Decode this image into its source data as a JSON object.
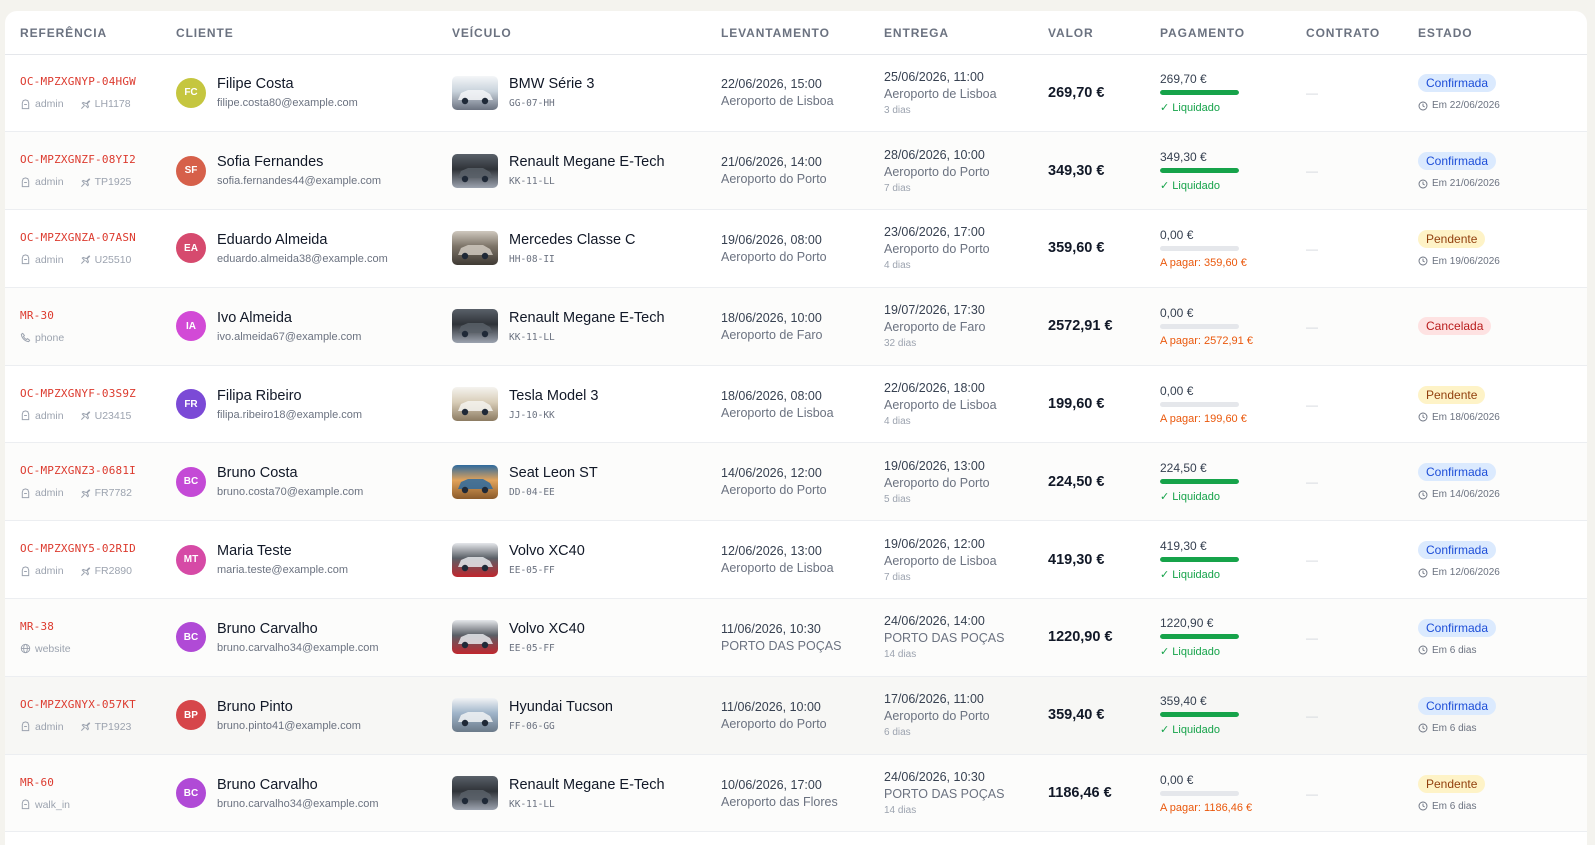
{
  "headers": [
    "REFERÊNCIA",
    "CLIENTE",
    "VEÍCULO",
    "LEVANTAMENTO",
    "ENTREGA",
    "VALOR",
    "PAGAMENTO",
    "CONTRATO",
    "ESTADO"
  ],
  "rows": [
    {
      "ref": "OC-MPZXGNYP-04HGW",
      "source": "admin",
      "flight": "LH1178",
      "source_icon": "user-icon",
      "initials": "FC",
      "avatar_color": "#c5c63f",
      "name": "Filipe Costa",
      "email": "filipe.costa80@example.com",
      "vehicle": "BMW Série 3",
      "plate": "GG-07-HH",
      "thumb": [
        "#c9d3dc",
        "#f4f6f8",
        "#6b7280"
      ],
      "pickup_dt": "22/06/2026, 15:00",
      "pickup_loc": "Aeroporto de Lisboa",
      "return_dt": "25/06/2026, 11:00",
      "return_loc": "Aeroporto de Lisboa",
      "days": "3 dias",
      "valor": "269,70 €",
      "paid": "269,70 €",
      "paid_ratio": 1,
      "pay_status": "✓ Liquidado",
      "pay_state": "ok",
      "contract": "—",
      "status": "Confirmada",
      "status_type": "conf",
      "status_sub": "Em 22/06/2026"
    },
    {
      "ref": "OC-MPZXGNZF-08YI2",
      "source": "admin",
      "flight": "TP1925",
      "source_icon": "user-icon",
      "initials": "SF",
      "avatar_color": "#d6604a",
      "name": "Sofia Fernandes",
      "email": "sofia.fernandes44@example.com",
      "vehicle": "Renault Megane E-Tech",
      "plate": "KK-11-LL",
      "thumb": [
        "#2f3338",
        "#596069",
        "#9ca3af"
      ],
      "pickup_dt": "21/06/2026, 14:00",
      "pickup_loc": "Aeroporto do Porto",
      "return_dt": "28/06/2026, 10:00",
      "return_loc": "Aeroporto do Porto",
      "days": "7 dias",
      "valor": "349,30 €",
      "paid": "349,30 €",
      "paid_ratio": 1,
      "pay_status": "✓ Liquidado",
      "pay_state": "ok",
      "contract": "—",
      "status": "Confirmada",
      "status_type": "conf",
      "status_sub": "Em 21/06/2026"
    },
    {
      "ref": "OC-MPZXGNZA-07ASN",
      "source": "admin",
      "flight": "U25510",
      "source_icon": "user-icon",
      "initials": "EA",
      "avatar_color": "#d64a6e",
      "name": "Eduardo Almeida",
      "email": "eduardo.almeida38@example.com",
      "vehicle": "Mercedes Classe C",
      "plate": "HH-08-II",
      "thumb": [
        "#7d7468",
        "#cfc8be",
        "#3f3a34"
      ],
      "pickup_dt": "19/06/2026, 08:00",
      "pickup_loc": "Aeroporto do Porto",
      "return_dt": "23/06/2026, 17:00",
      "return_loc": "Aeroporto do Porto",
      "days": "4 dias",
      "valor": "359,60 €",
      "paid": "0,00 €",
      "paid_ratio": 0,
      "pay_status": "A pagar: 359,60 €",
      "pay_state": "due",
      "contract": "—",
      "status": "Pendente",
      "status_type": "pend",
      "status_sub": "Em 19/06/2026"
    },
    {
      "ref": "MR-30",
      "source": "phone",
      "flight": "",
      "source_icon": "phone-icon",
      "initials": "IA",
      "avatar_color": "#d24ad6",
      "name": "Ivo Almeida",
      "email": "ivo.almeida67@example.com",
      "vehicle": "Renault Megane E-Tech",
      "plate": "KK-11-LL",
      "thumb": [
        "#2f3338",
        "#596069",
        "#9ca3af"
      ],
      "pickup_dt": "18/06/2026, 10:00",
      "pickup_loc": "Aeroporto de Faro",
      "return_dt": "19/07/2026, 17:30",
      "return_loc": "Aeroporto de Faro",
      "days": "32 dias",
      "valor": "2572,91 €",
      "paid": "0,00 €",
      "paid_ratio": 0,
      "pay_status": "A pagar: 2572,91 €",
      "pay_state": "due",
      "contract": "—",
      "status": "Cancelada",
      "status_type": "canc",
      "status_sub": ""
    },
    {
      "ref": "OC-MPZXGNYF-03S9Z",
      "source": "admin",
      "flight": "U23415",
      "source_icon": "user-icon",
      "initials": "FR",
      "avatar_color": "#7b4ad6",
      "name": "Filipa Ribeiro",
      "email": "filipa.ribeiro18@example.com",
      "vehicle": "Tesla Model 3",
      "plate": "JJ-10-KK",
      "thumb": [
        "#d8cdb8",
        "#f5f3ef",
        "#8c7b62"
      ],
      "pickup_dt": "18/06/2026, 08:00",
      "pickup_loc": "Aeroporto de Lisboa",
      "return_dt": "22/06/2026, 18:00",
      "return_loc": "Aeroporto de Lisboa",
      "days": "4 dias",
      "valor": "199,60 €",
      "paid": "0,00 €",
      "paid_ratio": 0,
      "pay_status": "A pagar: 199,60 €",
      "pay_state": "due",
      "contract": "—",
      "status": "Pendente",
      "status_type": "pend",
      "status_sub": "Em 18/06/2026"
    },
    {
      "ref": "OC-MPZXGNZ3-0681I",
      "source": "admin",
      "flight": "FR7782",
      "source_icon": "user-icon",
      "initials": "BC",
      "avatar_color": "#c44ad6",
      "name": "Bruno Costa",
      "email": "bruno.costa70@example.com",
      "vehicle": "Seat Leon ST",
      "plate": "DD-04-EE",
      "thumb": [
        "#e2a35a",
        "#2d6a9f",
        "#8a5a2b"
      ],
      "pickup_dt": "14/06/2026, 12:00",
      "pickup_loc": "Aeroporto do Porto",
      "return_dt": "19/06/2026, 13:00",
      "return_loc": "Aeroporto do Porto",
      "days": "5 dias",
      "valor": "224,50 €",
      "paid": "224,50 €",
      "paid_ratio": 1,
      "pay_status": "✓ Liquidado",
      "pay_state": "ok",
      "contract": "—",
      "status": "Confirmada",
      "status_type": "conf",
      "status_sub": "Em 14/06/2026"
    },
    {
      "ref": "OC-MPZXGNY5-02RID",
      "source": "admin",
      "flight": "FR2890",
      "source_icon": "user-icon",
      "initials": "MT",
      "avatar_color": "#d64aa6",
      "name": "Maria Teste",
      "email": "maria.teste@example.com",
      "vehicle": "Volvo XC40",
      "plate": "EE-05-FF",
      "thumb": [
        "#5a5f66",
        "#e5e7eb",
        "#c0262d"
      ],
      "pickup_dt": "12/06/2026, 13:00",
      "pickup_loc": "Aeroporto de Lisboa",
      "return_dt": "19/06/2026, 12:00",
      "return_loc": "Aeroporto de Lisboa",
      "days": "7 dias",
      "valor": "419,30 €",
      "paid": "419,30 €",
      "paid_ratio": 1,
      "pay_status": "✓ Liquidado",
      "pay_state": "ok",
      "contract": "—",
      "status": "Confirmada",
      "status_type": "conf",
      "status_sub": "Em 12/06/2026"
    },
    {
      "ref": "MR-38",
      "source": "website",
      "flight": "",
      "source_icon": "globe-icon",
      "initials": "BC",
      "avatar_color": "#b04ad6",
      "name": "Bruno Carvalho",
      "email": "bruno.carvalho34@example.com",
      "vehicle": "Volvo XC40",
      "plate": "EE-05-FF",
      "thumb": [
        "#5a5f66",
        "#e5e7eb",
        "#c0262d"
      ],
      "pickup_dt": "11/06/2026, 10:30",
      "pickup_loc": "PORTO DAS POÇAS",
      "return_dt": "24/06/2026, 14:00",
      "return_loc": "PORTO DAS POÇAS",
      "days": "14 dias",
      "valor": "1220,90 €",
      "paid": "1220,90 €",
      "paid_ratio": 1,
      "pay_status": "✓ Liquidado",
      "pay_state": "ok",
      "contract": "—",
      "status": "Confirmada",
      "status_type": "conf",
      "status_sub": "Em 6 dias"
    },
    {
      "ref": "OC-MPZXGNYX-057KT",
      "source": "admin",
      "flight": "TP1923",
      "source_icon": "user-icon",
      "initials": "BP",
      "avatar_color": "#d6464a",
      "name": "Bruno Pinto",
      "email": "bruno.pinto41@example.com",
      "vehicle": "Hyundai Tucson",
      "plate": "FF-06-GG",
      "thumb": [
        "#9fb4c9",
        "#f1f3f5",
        "#6b7a89"
      ],
      "pickup_dt": "11/06/2026, 10:00",
      "pickup_loc": "Aeroporto do Porto",
      "return_dt": "17/06/2026, 11:00",
      "return_loc": "Aeroporto do Porto",
      "days": "6 dias",
      "valor": "359,40 €",
      "paid": "359,40 €",
      "paid_ratio": 1,
      "pay_status": "✓ Liquidado",
      "pay_state": "ok",
      "contract": "—",
      "status": "Confirmada",
      "status_type": "conf",
      "status_sub": "Em 6 dias"
    },
    {
      "ref": "MR-60",
      "source": "walk_in",
      "flight": "",
      "source_icon": "user-icon",
      "initials": "BC",
      "avatar_color": "#b04ad6",
      "name": "Bruno Carvalho",
      "email": "bruno.carvalho34@example.com",
      "vehicle": "Renault Megane E-Tech",
      "plate": "KK-11-LL",
      "thumb": [
        "#2f3338",
        "#596069",
        "#9ca3af"
      ],
      "pickup_dt": "10/06/2026, 17:00",
      "pickup_loc": "Aeroporto das Flores",
      "return_dt": "24/06/2026, 10:30",
      "return_loc": "PORTO DAS POÇAS",
      "days": "14 dias",
      "valor": "1186,46 €",
      "paid": "0,00 €",
      "paid_ratio": 0,
      "pay_status": "A pagar: 1186,46 €",
      "pay_state": "due",
      "contract": "—",
      "status": "Pendente",
      "status_type": "pend",
      "status_sub": "Em 6 dias"
    }
  ]
}
